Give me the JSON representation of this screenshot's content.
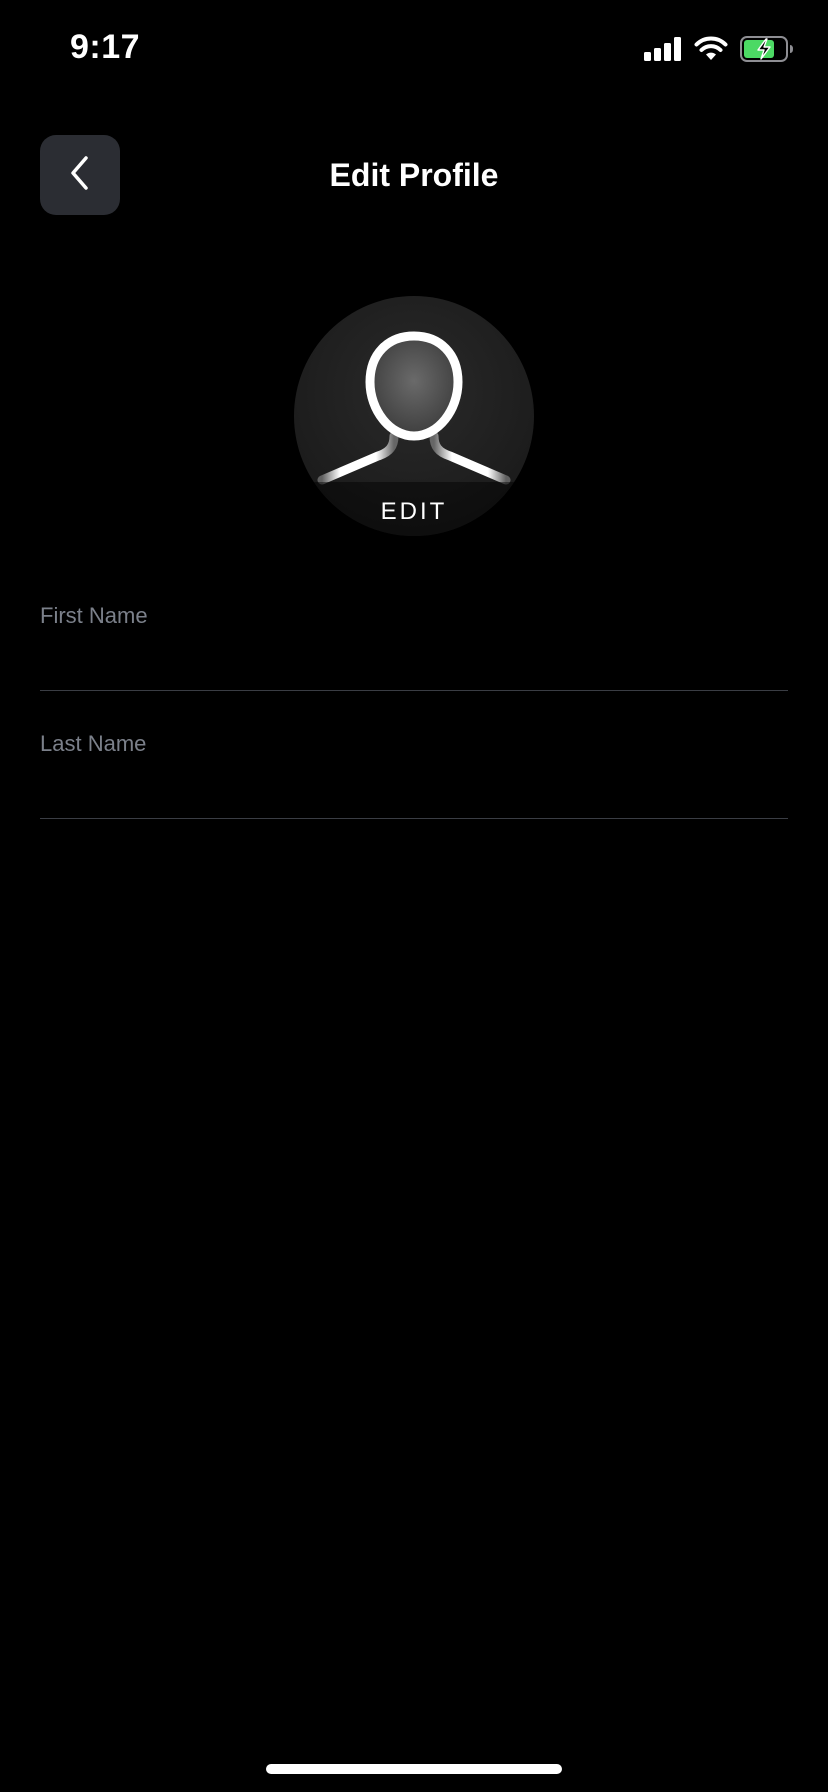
{
  "status_bar": {
    "time": "9:17",
    "icons": [
      "signal-icon",
      "wifi-icon",
      "battery-charging-icon"
    ],
    "battery_color": "#4cd964"
  },
  "header": {
    "title": "Edit Profile",
    "back_icon": "chevron-left-icon"
  },
  "avatar": {
    "icon": "person-silhouette-icon",
    "edit_label": "EDIT"
  },
  "form": {
    "first_name": {
      "placeholder": "First Name",
      "value": ""
    },
    "last_name": {
      "placeholder": "Last Name",
      "value": ""
    }
  },
  "colors": {
    "background": "#000000",
    "back_button_bg": "#2b2d33",
    "placeholder": "#7b808a",
    "divider": "#3a3d44"
  }
}
